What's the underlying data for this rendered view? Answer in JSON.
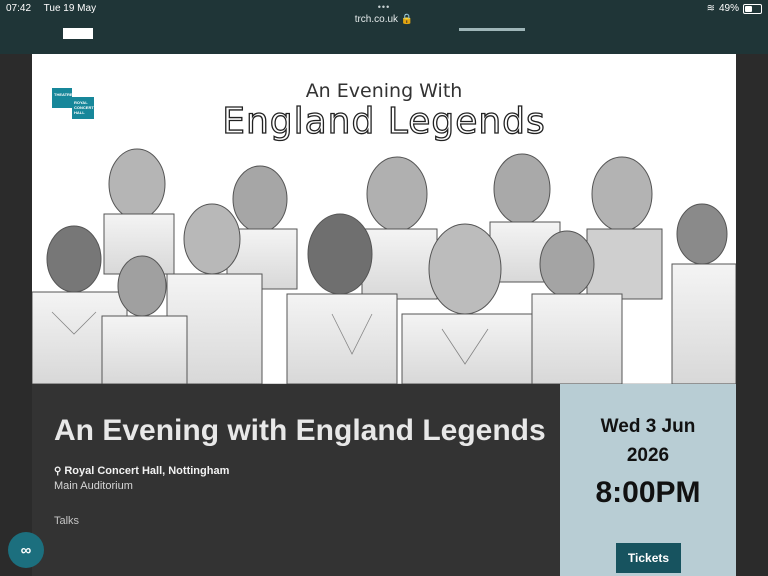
{
  "status_bar": {
    "time": "07:42",
    "date": "Tue 19 May",
    "url": "trch.co.uk",
    "battery": "49%",
    "battery_level": 0.49
  },
  "poster": {
    "logo_text_left": "THEATRE ROYAL",
    "logo_text_right": "ROYAL CONCERT HALL",
    "subtitle": "An Evening With",
    "title": "England Legends"
  },
  "event": {
    "title": "An Evening with England Legends",
    "venue": "Royal Concert Hall, Nottingham",
    "hall": "Main Auditorium",
    "category": "Talks"
  },
  "schedule": {
    "date_line1": "Wed 3 Jun",
    "date_line2": "2026",
    "time": "8:00PM",
    "tickets_label": "Tickets"
  },
  "icons": {
    "location": "location-pin-icon",
    "wifi": "wifi-icon",
    "battery": "battery-icon",
    "lock": "lock-icon",
    "fab": "link-icon"
  },
  "colors": {
    "accent": "#17535f",
    "panel_light": "#b8cdd4",
    "panel_dark": "#333333",
    "header": "#1f3537"
  }
}
